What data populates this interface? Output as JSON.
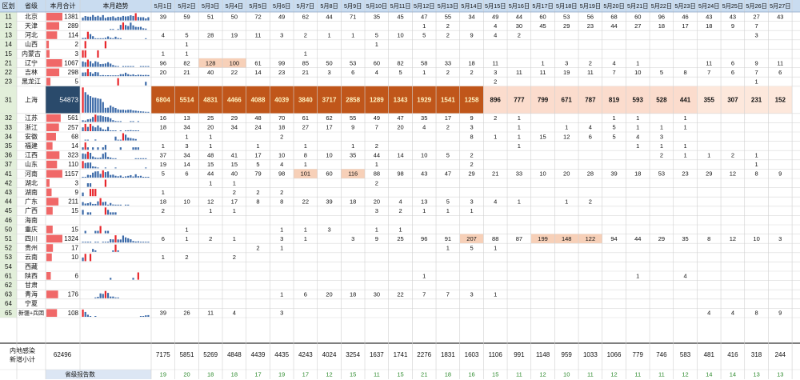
{
  "headers": [
    "区划",
    "省级",
    "本月合计",
    "本月趋势",
    "5月1日",
    "5月2日",
    "5月3日",
    "5月4日",
    "5月5日",
    "5月6日",
    "5月7日",
    "5月8日",
    "5月9日",
    "5月10日",
    "5月11日",
    "5月12日",
    "5月13日",
    "5月14日",
    "5月15日",
    "5月16日",
    "5月17日",
    "5月18日",
    "5月19日",
    "5月20日",
    "5月21日",
    "5月22日",
    "5月23日",
    "5月24日",
    "5月25日",
    "5月26日",
    "5月27日"
  ],
  "chart_data": {
    "type": "table",
    "dates": [
      "5月1日",
      "5月2日",
      "5月3日",
      "5月4日",
      "5月5日",
      "5月6日",
      "5月7日",
      "5月8日",
      "5月9日",
      "5月10日",
      "5月11日",
      "5月12日",
      "5月13日",
      "5月14日",
      "5月15日",
      "5月16日",
      "5月17日",
      "5月18日",
      "5月19日",
      "5月20日",
      "5月21日",
      "5月22日",
      "5月23日",
      "5月24日",
      "5月25日",
      "5月26日",
      "5月27日"
    ],
    "rows": [
      {
        "code": "11",
        "name": "北京",
        "total": "1381",
        "days": [
          "39",
          "59",
          "51",
          "50",
          "72",
          "49",
          "62",
          "44",
          "71",
          "35",
          "45",
          "47",
          "55",
          "34",
          "49",
          "44",
          "60",
          "53",
          "56",
          "68",
          "60",
          "96",
          "46",
          "43",
          "43",
          "27",
          "43"
        ]
      },
      {
        "code": "12",
        "name": "天津",
        "total": "289",
        "days": [
          "",
          "",
          "",
          "",
          "",
          "",
          "",
          "",
          "",
          "",
          "",
          "1",
          "2",
          "",
          "4",
          "30",
          "45",
          "29",
          "23",
          "44",
          "27",
          "18",
          "17",
          "18",
          "9",
          "7",
          ""
        ]
      },
      {
        "code": "13",
        "name": "河北",
        "total": "114",
        "days": [
          "4",
          "5",
          "28",
          "19",
          "11",
          "3",
          "2",
          "1",
          "1",
          "5",
          "10",
          "5",
          "2",
          "9",
          "4",
          "2",
          "",
          "",
          "",
          "",
          "",
          "",
          "",
          "",
          "",
          "3",
          ""
        ]
      },
      {
        "code": "14",
        "name": "山西",
        "total": "2",
        "days": [
          "",
          "1",
          "",
          "",
          "",
          "",
          "",
          "",
          "",
          "1",
          "",
          "",
          "",
          "",
          "",
          "",
          "",
          "",
          "",
          "",
          "",
          "",
          "",
          "",
          "",
          "",
          ""
        ]
      },
      {
        "code": "15",
        "name": "内蒙古",
        "total": "3",
        "days": [
          "1",
          "1",
          "",
          "",
          "",
          "",
          "1",
          "",
          "",
          "",
          "",
          "",
          "",
          "",
          "",
          "",
          "",
          "",
          "",
          "",
          "",
          "",
          "",
          "",
          "",
          "",
          ""
        ]
      },
      {
        "code": "21",
        "name": "辽宁",
        "total": "1067",
        "days": [
          "96",
          "82",
          "128",
          "100",
          "61",
          "99",
          "85",
          "50",
          "53",
          "60",
          "82",
          "58",
          "33",
          "18",
          "11",
          "",
          "1",
          "3",
          "2",
          "4",
          "1",
          "",
          "",
          "11",
          "6",
          "9",
          "11"
        ]
      },
      {
        "code": "22",
        "name": "吉林",
        "total": "298",
        "days": [
          "20",
          "21",
          "40",
          "22",
          "14",
          "23",
          "21",
          "3",
          "6",
          "4",
          "5",
          "1",
          "2",
          "2",
          "3",
          "11",
          "11",
          "19",
          "11",
          "7",
          "10",
          "5",
          "8",
          "7",
          "6",
          "7",
          "6"
        ]
      },
      {
        "code": "23",
        "name": "黑龙江",
        "total": "5",
        "days": [
          "",
          "",
          "",
          "",
          "",
          "",
          "",
          "",
          "",
          "",
          "",
          "",
          "",
          "",
          "2",
          "",
          "",
          "",
          "",
          "",
          "",
          "",
          "",
          "",
          "",
          "1",
          ""
        ]
      },
      {
        "code": "31",
        "name": "上海",
        "total": "54873",
        "days": [
          "6804",
          "5514",
          "4831",
          "4466",
          "4088",
          "4039",
          "3840",
          "3717",
          "2858",
          "1289",
          "1343",
          "1929",
          "1541",
          "1258",
          "896",
          "777",
          "799",
          "671",
          "787",
          "819",
          "593",
          "528",
          "441",
          "355",
          "307",
          "231",
          "152"
        ]
      },
      {
        "code": "32",
        "name": "江苏",
        "total": "561",
        "days": [
          "16",
          "13",
          "25",
          "29",
          "48",
          "70",
          "61",
          "62",
          "55",
          "49",
          "47",
          "35",
          "17",
          "9",
          "2",
          "1",
          "",
          "",
          "",
          "1",
          "1",
          "",
          "1",
          "",
          "",
          "",
          ""
        ]
      },
      {
        "code": "33",
        "name": "浙江",
        "total": "257",
        "days": [
          "18",
          "34",
          "20",
          "34",
          "24",
          "18",
          "27",
          "17",
          "9",
          "7",
          "20",
          "4",
          "2",
          "3",
          "",
          "1",
          "",
          "1",
          "4",
          "5",
          "1",
          "1",
          "1",
          "",
          "",
          "",
          ""
        ]
      },
      {
        "code": "34",
        "name": "安徽",
        "total": "68",
        "days": [
          "",
          "1",
          "1",
          "",
          "",
          "2",
          "",
          "",
          "",
          "",
          "",
          "",
          "",
          "8",
          "1",
          "1",
          "15",
          "12",
          "6",
          "5",
          "4",
          "3",
          "",
          "",
          "",
          "",
          ""
        ]
      },
      {
        "code": "35",
        "name": "福建",
        "total": "14",
        "days": [
          "1",
          "3",
          "1",
          "",
          "1",
          "",
          "1",
          "",
          "1",
          "2",
          "",
          "",
          "",
          "",
          "",
          "1",
          "",
          "",
          "",
          "",
          "1",
          "1",
          "1",
          "",
          "",
          "",
          ""
        ]
      },
      {
        "code": "36",
        "name": "江西",
        "total": "323",
        "days": [
          "37",
          "34",
          "48",
          "41",
          "17",
          "10",
          "8",
          "10",
          "35",
          "44",
          "14",
          "10",
          "5",
          "2",
          "",
          "",
          "",
          "",
          "",
          "",
          "",
          "2",
          "1",
          "1",
          "2",
          "1",
          ""
        ]
      },
      {
        "code": "37",
        "name": "山东",
        "total": "110",
        "days": [
          "19",
          "14",
          "15",
          "15",
          "5",
          "4",
          "1",
          "",
          "",
          "1",
          "",
          "",
          "",
          "2",
          "",
          "",
          "",
          "",
          "",
          "",
          "",
          "",
          "",
          "",
          "",
          "1",
          ""
        ]
      },
      {
        "code": "41",
        "name": "河南",
        "total": "1157",
        "days": [
          "5",
          "6",
          "44",
          "40",
          "79",
          "98",
          "101",
          "60",
          "116",
          "88",
          "98",
          "43",
          "47",
          "29",
          "21",
          "33",
          "10",
          "20",
          "28",
          "39",
          "18",
          "53",
          "23",
          "29",
          "12",
          "8",
          "9"
        ]
      },
      {
        "code": "42",
        "name": "湖北",
        "total": "3",
        "days": [
          "",
          "",
          "1",
          "1",
          "",
          "",
          "",
          "",
          "",
          "2",
          "",
          "",
          "",
          "",
          "",
          "",
          "",
          "",
          "",
          "",
          "",
          "",
          "",
          "",
          "",
          "",
          ""
        ]
      },
      {
        "code": "43",
        "name": "湖南",
        "total": "9",
        "days": [
          "1",
          "",
          "",
          "2",
          "2",
          "2",
          "",
          "",
          "",
          "",
          "",
          "",
          "",
          "",
          "",
          "",
          "",
          "",
          "",
          "",
          "",
          "",
          "",
          "",
          "",
          "",
          ""
        ]
      },
      {
        "code": "44",
        "name": "广东",
        "total": "211",
        "days": [
          "18",
          "10",
          "12",
          "17",
          "8",
          "8",
          "22",
          "39",
          "18",
          "20",
          "4",
          "13",
          "5",
          "3",
          "4",
          "1",
          "",
          "1",
          "2",
          "",
          "",
          "",
          "",
          "",
          "",
          "",
          ""
        ]
      },
      {
        "code": "45",
        "name": "广西",
        "total": "15",
        "days": [
          "2",
          "",
          "1",
          "1",
          "",
          "",
          "",
          "",
          "",
          "3",
          "2",
          "1",
          "1",
          "1",
          "",
          "",
          "",
          "",
          "",
          "",
          "",
          "",
          "",
          "",
          "",
          "",
          ""
        ]
      },
      {
        "code": "46",
        "name": "海南",
        "total": "",
        "days": [
          "",
          "",
          "",
          "",
          "",
          "",
          "",
          "",
          "",
          "",
          "",
          "",
          "",
          "",
          "",
          "",
          "",
          "",
          "",
          "",
          "",
          "",
          "",
          "",
          "",
          "",
          ""
        ]
      },
      {
        "code": "50",
        "name": "重庆",
        "total": "15",
        "days": [
          "",
          "1",
          "",
          "",
          "",
          "1",
          "1",
          "3",
          "",
          "1",
          "1",
          "",
          "",
          "",
          "",
          "",
          "",
          "",
          "",
          "",
          "",
          "",
          "",
          "",
          "",
          "",
          ""
        ]
      },
      {
        "code": "51",
        "name": "四川",
        "total": "1324",
        "days": [
          "6",
          "1",
          "2",
          "1",
          "",
          "3",
          "1",
          "",
          "3",
          "9",
          "25",
          "96",
          "91",
          "207",
          "88",
          "87",
          "199",
          "148",
          "122",
          "94",
          "44",
          "29",
          "35",
          "8",
          "12",
          "10",
          "3"
        ]
      },
      {
        "code": "52",
        "name": "贵州",
        "total": "17",
        "days": [
          "",
          "",
          "",
          "",
          "2",
          "1",
          "",
          "",
          "",
          "",
          "",
          "",
          "1",
          "5",
          "1",
          "",
          "",
          "",
          "",
          "",
          "",
          "",
          "",
          "",
          "",
          "",
          ""
        ]
      },
      {
        "code": "53",
        "name": "云南",
        "total": "10",
        "days": [
          "1",
          "2",
          "",
          "2",
          "",
          "",
          "",
          "",
          "",
          "",
          "",
          "",
          "",
          "",
          "",
          "",
          "",
          "",
          "",
          "",
          "",
          "",
          "",
          "",
          "",
          "",
          ""
        ]
      },
      {
        "code": "54",
        "name": "西藏",
        "total": "",
        "days": [
          "",
          "",
          "",
          "",
          "",
          "",
          "",
          "",
          "",
          "",
          "",
          "",
          "",
          "",
          "",
          "",
          "",
          "",
          "",
          "",
          "",
          "",
          "",
          "",
          "",
          "",
          ""
        ]
      },
      {
        "code": "61",
        "name": "陕西",
        "total": "6",
        "days": [
          "",
          "",
          "",
          "",
          "",
          "",
          "",
          "",
          "",
          "",
          "",
          "1",
          "",
          "",
          "",
          "",
          "",
          "",
          "",
          "",
          "1",
          "",
          "4",
          "",
          "",
          "",
          ""
        ]
      },
      {
        "code": "62",
        "name": "甘肃",
        "total": "",
        "days": [
          "",
          "",
          "",
          "",
          "",
          "",
          "",
          "",
          "",
          "",
          "",
          "",
          "",
          "",
          "",
          "",
          "",
          "",
          "",
          "",
          "",
          "",
          "",
          "",
          "",
          "",
          ""
        ]
      },
      {
        "code": "63",
        "name": "青海",
        "total": "176",
        "days": [
          "",
          "",
          "",
          "",
          "",
          "1",
          "6",
          "20",
          "18",
          "30",
          "22",
          "7",
          "7",
          "3",
          "1",
          "",
          "",
          "",
          "",
          "",
          "",
          "",
          "",
          "",
          "",
          "",
          ""
        ]
      },
      {
        "code": "64",
        "name": "宁夏",
        "total": "",
        "days": [
          "",
          "",
          "",
          "",
          "",
          "",
          "",
          "",
          "",
          "",
          "",
          "",
          "",
          "",
          "",
          "",
          "",
          "",
          "",
          "",
          "",
          "",
          "",
          "",
          "",
          "",
          ""
        ]
      },
      {
        "code": "65",
        "name": "新疆+兵团",
        "total": "108",
        "days": [
          "39",
          "26",
          "11",
          "4",
          "",
          "3",
          "",
          "",
          "",
          "",
          "",
          "",
          "",
          "",
          "",
          "",
          "",
          "",
          "",
          "",
          "",
          "",
          "",
          "4",
          "4",
          "8",
          "9"
        ]
      }
    ],
    "summary": {
      "label1": "内地感染",
      "label2": "新增小计",
      "total": "62496",
      "reports_label": "省级报告数",
      "totals": [
        "7175",
        "5851",
        "5269",
        "4848",
        "4439",
        "4435",
        "4243",
        "4024",
        "3254",
        "1637",
        "1741",
        "2276",
        "1831",
        "1603",
        "1106",
        "991",
        "1148",
        "959",
        "1033",
        "1066",
        "779",
        "746",
        "583",
        "481",
        "416",
        "318",
        "244"
      ],
      "reports": [
        "19",
        "20",
        "18",
        "18",
        "17",
        "19",
        "17",
        "12",
        "15",
        "11",
        "15",
        "21",
        "18",
        "16",
        "15",
        "11",
        "12",
        "10",
        "11",
        "12",
        "11",
        "11",
        "12",
        "14",
        "14",
        "13",
        "13"
      ]
    }
  }
}
